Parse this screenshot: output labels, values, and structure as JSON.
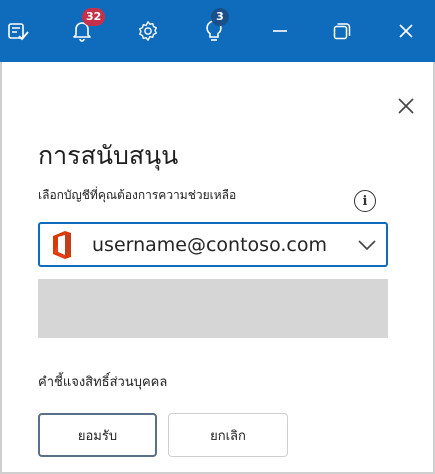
{
  "titlebar": {
    "background": "#0f6cbd",
    "notifications_count": "32",
    "tips_count": "3",
    "icons": [
      "tasks-icon",
      "bell-icon",
      "gear-icon",
      "lightbulb-icon",
      "minimize-icon",
      "restore-icon",
      "close-icon"
    ]
  },
  "panel": {
    "heading": "การสนับสนุน",
    "description": "เลือกบัญชีที่คุณต้องการความช่วยเหลือ",
    "account": {
      "selected": "username@contoso.com",
      "icon": "office-logo"
    },
    "privacy_link": "คำชี้แจงสิทธิ์ส่วนบุคคล",
    "accept_label": "ยอมรับ",
    "cancel_label": "ยกเลิก"
  },
  "colors": {
    "accent": "#0f6cbd",
    "badge_red": "#c4314b",
    "badge_blue": "#1b4f8a",
    "placeholder_grey": "#d6d6d6"
  }
}
